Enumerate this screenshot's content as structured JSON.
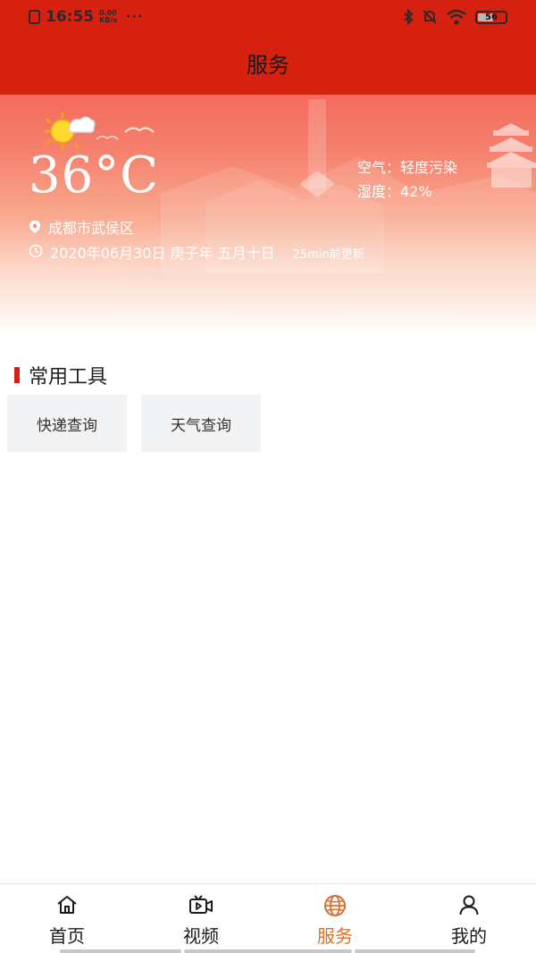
{
  "status_bar": {
    "time": "16:55",
    "network_speed": "0.00 KB/s",
    "dots": "···",
    "battery": "56",
    "battery_level_percent": 56,
    "icons": [
      "sim-icon",
      "bluetooth-icon",
      "mute-icon",
      "wifi-icon",
      "battery-icon"
    ]
  },
  "header": {
    "title": "服务"
  },
  "weather": {
    "temperature": "36°C",
    "air_quality": "空气：轻度污染",
    "humidity": "湿度：42%",
    "location": "成都市武侯区",
    "date": "2020年06月30日 庚子年 五月十日",
    "updated": "25min前更新"
  },
  "tools": {
    "section_title": "常用工具",
    "items": [
      {
        "label": "快递查询"
      },
      {
        "label": "天气查询"
      }
    ]
  },
  "bottom_nav": {
    "items": [
      {
        "label": "首页",
        "icon": "home-icon",
        "active": false
      },
      {
        "label": "视频",
        "icon": "video-icon",
        "active": false
      },
      {
        "label": "服务",
        "icon": "globe-icon",
        "active": true
      },
      {
        "label": "我的",
        "icon": "user-icon",
        "active": false
      }
    ]
  },
  "colors": {
    "header_red": "#d62010",
    "active_tab": "#d86f2a",
    "tool_bg": "#f2f3f5"
  }
}
